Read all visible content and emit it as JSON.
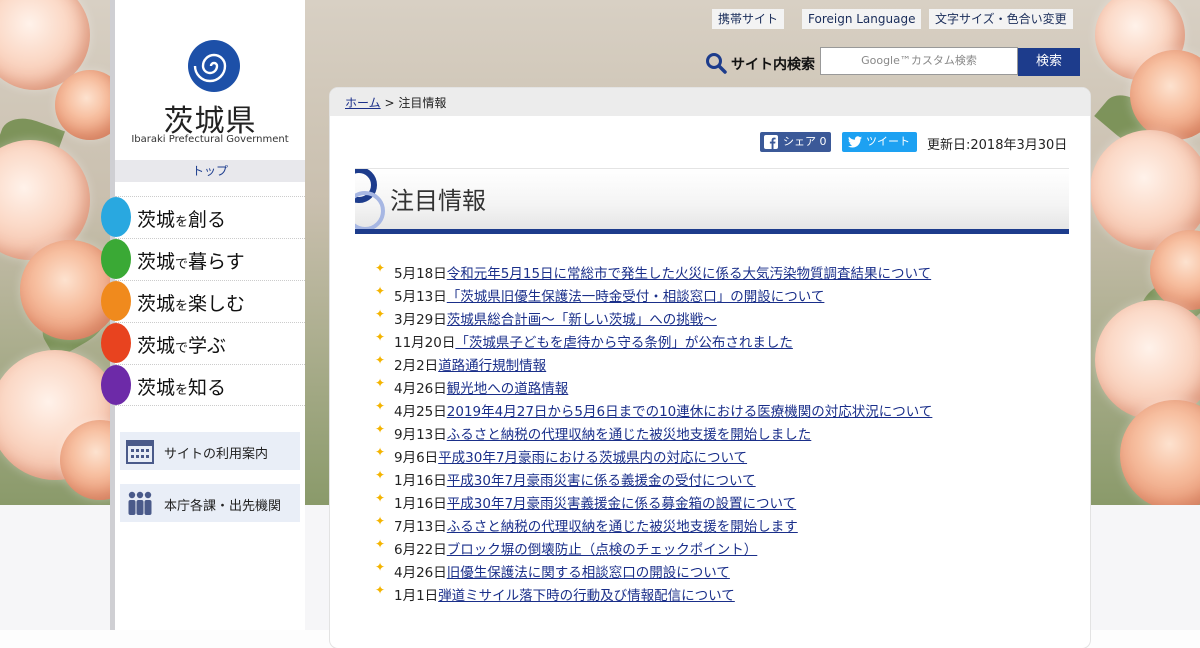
{
  "site": {
    "logo_title": "茨城県",
    "logo_subtitle": "Ibaraki Prefectural Government",
    "top_link": "トップ"
  },
  "menu": [
    {
      "label_main": "茨城",
      "label_particle": "を",
      "label_end": "創る",
      "color": "#29a8e0"
    },
    {
      "label_main": "茨城",
      "label_particle": "で",
      "label_end": "暮らす",
      "color": "#3aa935"
    },
    {
      "label_main": "茨城",
      "label_particle": "を",
      "label_end": "楽しむ",
      "color": "#f08a1d"
    },
    {
      "label_main": "茨城",
      "label_particle": "で",
      "label_end": "学ぶ",
      "color": "#e8431f"
    },
    {
      "label_main": "茨城",
      "label_particle": "を",
      "label_end": "知る",
      "color": "#6d2aa8"
    }
  ],
  "utility": {
    "site_guide": "サイトの利用案内",
    "departments": "本庁各課・出先機関"
  },
  "header": {
    "mobile_site": "携帯サイト",
    "foreign_language": "Foreign Language",
    "font_color": "文字サイズ・色合い変更"
  },
  "search": {
    "label": "サイト内検索",
    "placeholder": "Google™カスタム検索",
    "button": "検索"
  },
  "breadcrumb": {
    "home": "ホーム",
    "separator": " > ",
    "current": "注目情報"
  },
  "share": {
    "facebook": "シェア 0",
    "twitter": "ツイート",
    "updated": "更新日:2018年3月30日"
  },
  "page_title": "注目情報",
  "news": [
    {
      "date": "5月18日",
      "text": "令和元年5月15日に常総市で発生した火災に係る大気汚染物質調査結果について"
    },
    {
      "date": "5月13日",
      "text": "「茨城県旧優生保護法一時金受付・相談窓口」の開設について"
    },
    {
      "date": "3月29日",
      "text": "茨城県総合計画～「新しい茨城」への挑戦～"
    },
    {
      "date": "11月20日",
      "text": "「茨城県子どもを虐待から守る条例」が公布されました"
    },
    {
      "date": "2月2日",
      "text": "道路通行規制情報"
    },
    {
      "date": "4月26日",
      "text": "観光地への道路情報"
    },
    {
      "date": "4月25日",
      "text": "2019年4月27日から5月6日までの10連休における医療機関の対応状況について"
    },
    {
      "date": "9月13日",
      "text": "ふるさと納税の代理収納を通じた被災地支援を開始しました"
    },
    {
      "date": "9月6日",
      "text": "平成30年7月豪雨における茨城県内の対応について"
    },
    {
      "date": "1月16日",
      "text": "平成30年7月豪雨災害に係る義援金の受付について"
    },
    {
      "date": "1月16日",
      "text": "平成30年7月豪雨災害義援金に係る募金箱の設置について"
    },
    {
      "date": "7月13日",
      "text": "ふるさと納税の代理収納を通じた被災地支援を開始します"
    },
    {
      "date": "6月22日",
      "text": "ブロック塀の倒壊防止（点検のチェックポイント）"
    },
    {
      "date": "4月26日",
      "text": "旧優生保護法に関する相談窓口の開設について"
    },
    {
      "date": "1月1日",
      "text": "弾道ミサイル落下時の行動及び情報配信について"
    }
  ]
}
